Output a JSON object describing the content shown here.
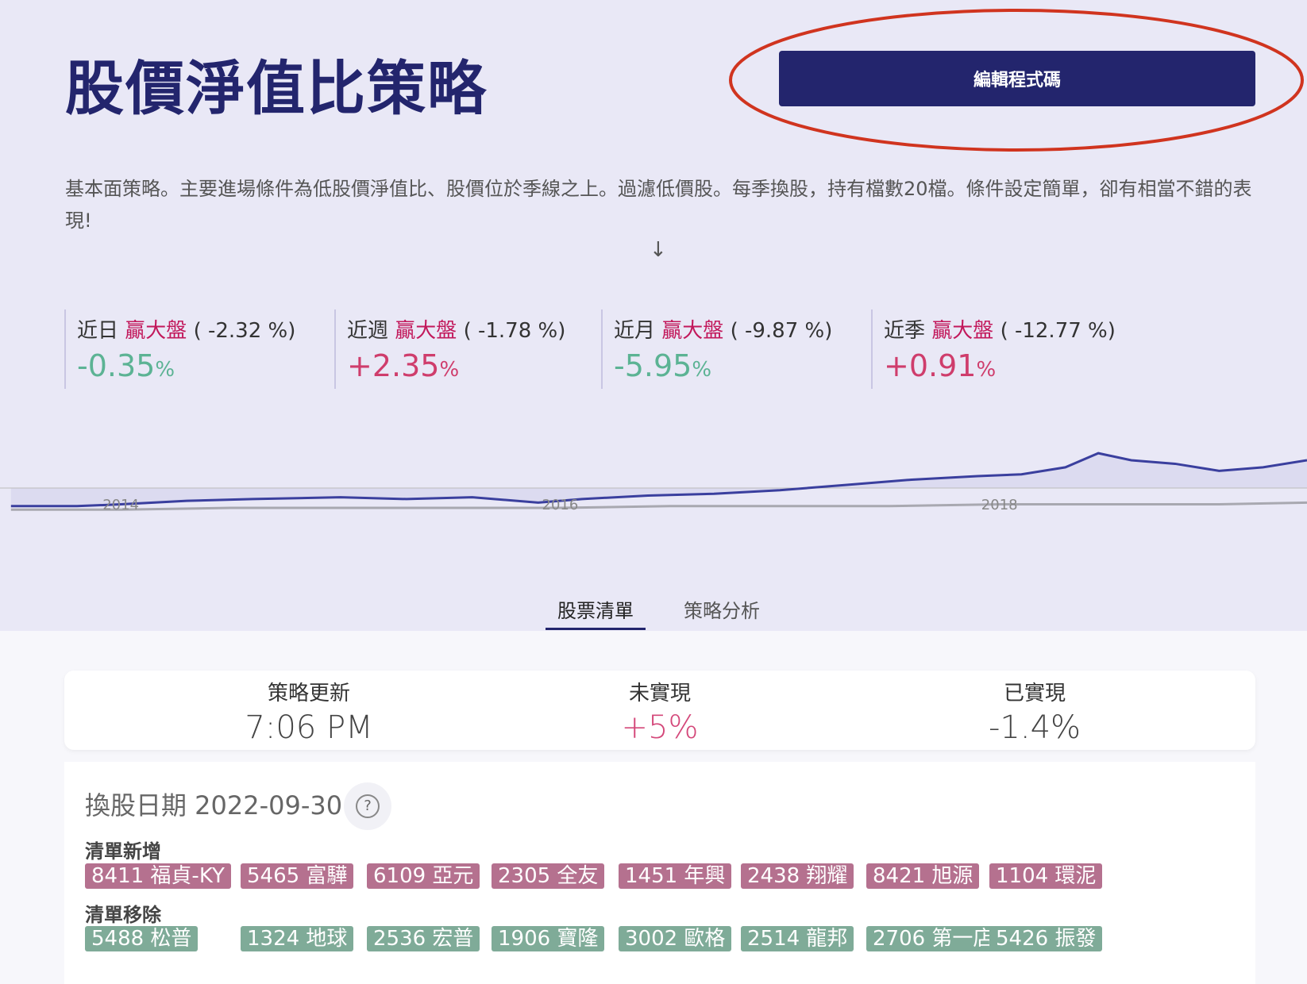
{
  "header": {
    "title": "股價淨值比策略",
    "edit_button": "編輯程式碼"
  },
  "description": "基本面策略。主要進場條件為低股價淨值比、股價位於季線之上。過濾低價股。每季換股，持有檔數20檔。條件設定簡單，卻有相當不錯的表現!",
  "scroll_arrow": "↓",
  "stats": [
    {
      "period": "近日",
      "beat": "贏大盤",
      "benchmark": "( -2.32 %)",
      "value": "-0.35",
      "unit": "%",
      "sign": "neg"
    },
    {
      "period": "近週",
      "beat": "贏大盤",
      "benchmark": "( -1.78 %)",
      "value": "+2.35",
      "unit": "%",
      "sign": "pos"
    },
    {
      "period": "近月",
      "beat": "贏大盤",
      "benchmark": "( -9.87 %)",
      "value": "-5.95",
      "unit": "%",
      "sign": "neg"
    },
    {
      "period": "近季",
      "beat": "贏大盤",
      "benchmark": "( -12.77 %)",
      "value": "+0.91",
      "unit": "%",
      "sign": "pos"
    }
  ],
  "chart_data": {
    "type": "line",
    "x_ticks": [
      "2014",
      "2016",
      "2018"
    ],
    "series": [
      {
        "color": "#3a3f9e",
        "x": [
          2013.5,
          2013.8,
          2014.0,
          2014.3,
          2014.6,
          2015.0,
          2015.3,
          2015.6,
          2015.9,
          2016.1,
          2016.4,
          2016.7,
          2017.0,
          2017.3,
          2017.6,
          2017.9,
          2018.1,
          2018.3,
          2018.45,
          2018.6,
          2018.8,
          2019.0,
          2019.2,
          2019.4
        ],
        "y": [
          1.0,
          1.0,
          1.01,
          1.03,
          1.04,
          1.05,
          1.04,
          1.05,
          1.02,
          1.04,
          1.06,
          1.07,
          1.09,
          1.12,
          1.15,
          1.17,
          1.18,
          1.22,
          1.3,
          1.26,
          1.24,
          1.2,
          1.22,
          1.26
        ]
      },
      {
        "color": "#a8a8b0",
        "x": [
          2013.5,
          2014.0,
          2014.5,
          2015.0,
          2015.5,
          2016.0,
          2016.5,
          2017.0,
          2017.5,
          2018.0,
          2018.5,
          2019.0,
          2019.4
        ],
        "y": [
          0.98,
          0.98,
          0.99,
          0.99,
          0.99,
          0.99,
          1.0,
          1.0,
          1.0,
          1.01,
          1.01,
          1.01,
          1.02
        ]
      }
    ]
  },
  "tabs": [
    {
      "label": "股票清單",
      "active": true
    },
    {
      "label": "策略分析",
      "active": false
    }
  ],
  "summary": {
    "update_label": "策略更新",
    "update_value": "7:06 PM",
    "unrealized_label": "未實現",
    "unrealized_value": "+5%",
    "realized_label": "已實現",
    "realized_value": "-1.4%"
  },
  "rebalance": {
    "title": "換股日期 2022-09-30",
    "help_icon": "?",
    "added_label": "清單新增",
    "added": [
      "8411 福貞-KY",
      "5465 富驊",
      "6109 亞元",
      "2305 全友",
      "1451 年興",
      "2438 翔耀",
      "8421 旭源",
      "1104 環泥"
    ],
    "removed_label": "清單移除",
    "removed": [
      "5488 松普",
      "1324 地球",
      "2536 宏普",
      "1906 寶隆",
      "3002 歐格",
      "2514 龍邦",
      "2706 第一店",
      "5426 振發"
    ]
  }
}
